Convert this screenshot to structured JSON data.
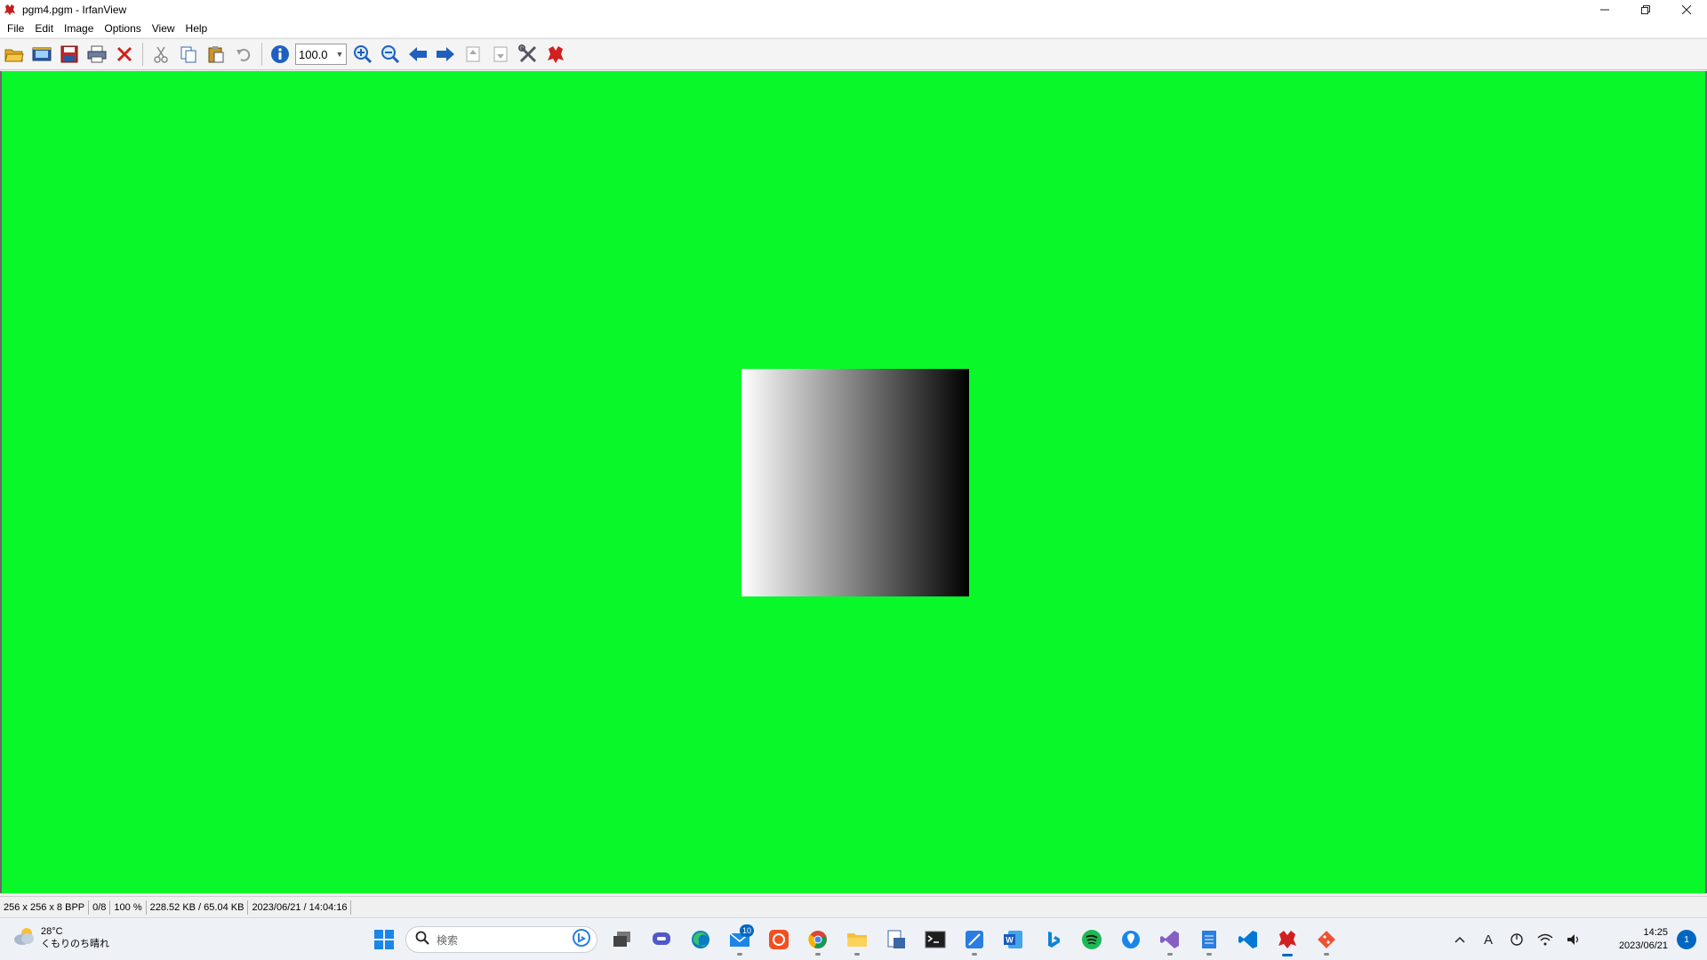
{
  "window": {
    "title": "pgm4.pgm - IrfanView",
    "app_icon": "irfanview-cat-icon",
    "controls": [
      "minimize-icon",
      "restore-icon",
      "close-icon"
    ]
  },
  "menu": [
    "File",
    "Edit",
    "Image",
    "Options",
    "View",
    "Help"
  ],
  "toolbar": {
    "zoom_value": "100.0",
    "buttons": [
      "open-folder-icon",
      "slideshow-icon",
      "save-icon",
      "print-icon",
      "delete-icon",
      "cut-icon",
      "copy-icon",
      "paste-icon",
      "undo-icon",
      "info-icon",
      "zoom-in-icon",
      "zoom-out-icon",
      "previous-icon",
      "next-icon",
      "first-page-icon",
      "last-page-icon",
      "settings-icon",
      "irfanview-icon"
    ]
  },
  "canvas": {
    "background": "#08f82a",
    "image_description_hidden": ""
  },
  "status": [
    "256 x 256 x 8 BPP",
    "0/8",
    "100 %",
    "228.52 KB / 65.04 KB",
    "2023/06/21 / 14:04:16"
  ],
  "taskbar": {
    "weather_temp": "28°C",
    "weather_desc": "くもりのち晴れ",
    "search_placeholder": "検索",
    "mail_badge": "10",
    "apps": [
      "task-view-icon",
      "teams-chat-icon",
      "edge-icon",
      "mail-icon",
      "app-orange-icon",
      "chrome-icon",
      "file-explorer-icon",
      "app-printer-icon",
      "terminal-icon",
      "app-blue-icon",
      "word-icon",
      "bing-icon",
      "spotify-icon",
      "maps-icon",
      "visual-studio-icon",
      "notepad-icon",
      "vscode-icon",
      "irfanview-icon",
      "git-icon"
    ],
    "ime": "A",
    "time": "14:25",
    "date": "2023/06/21",
    "notification_count": "1"
  }
}
